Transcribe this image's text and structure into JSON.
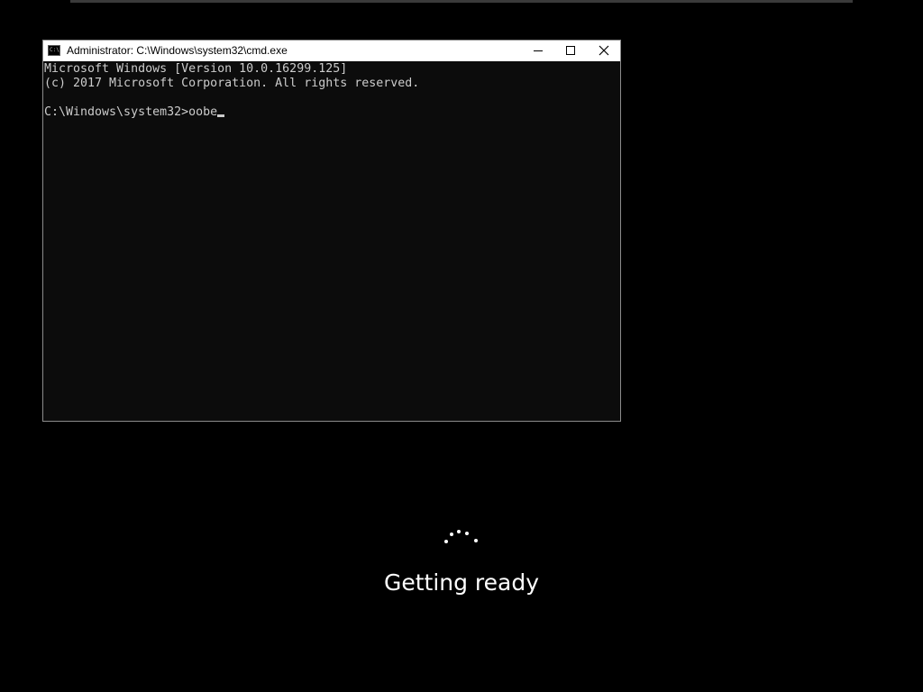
{
  "window": {
    "title": "Administrator: C:\\Windows\\system32\\cmd.exe",
    "icon": "cmd-icon",
    "icon_text": "C:\\"
  },
  "console": {
    "line1": "Microsoft Windows [Version 10.0.16299.125]",
    "line2": "(c) 2017 Microsoft Corporation. All rights reserved.",
    "prompt": "C:\\Windows\\system32>",
    "input": "oobe"
  },
  "oobe": {
    "status": "Getting ready",
    "spinner_icon": "loading-spinner-icon"
  },
  "colors": {
    "background": "#000000",
    "console_bg": "#0c0c0c",
    "console_text": "#cccccc",
    "titlebar": "#ffffff"
  }
}
